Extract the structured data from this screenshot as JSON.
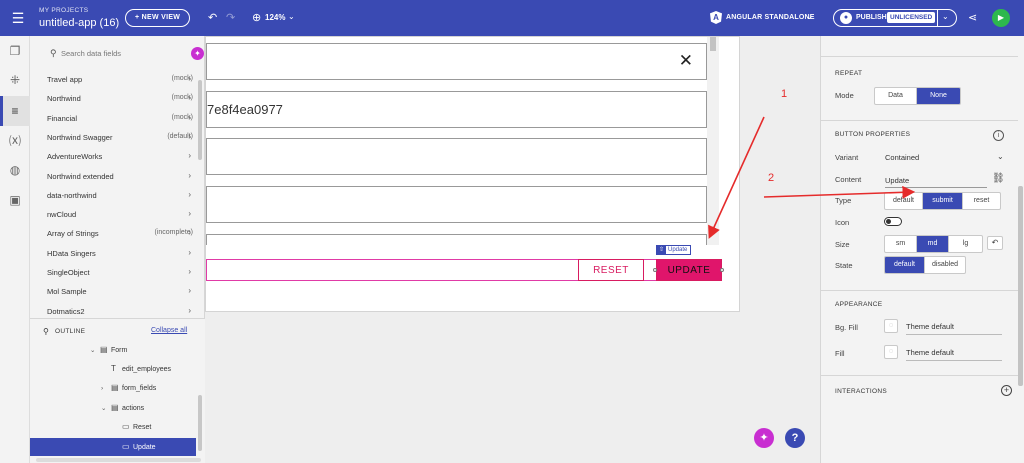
{
  "topbar": {
    "menu_icon": "hamburger-icon",
    "project_caption": "MY PROJECTS",
    "project_name": "untitled-app (16)",
    "new_view_label": "+ NEW VIEW",
    "zoom_value": "124%",
    "framework_label": "ANGULAR STANDALONE",
    "publish_label": "PUBLISH",
    "license_badge": "UNLICENSED",
    "accent": "#3a4ab3",
    "run_color": "#2db84d"
  },
  "datasources": {
    "search_placeholder": "Search data fields",
    "items": [
      {
        "name": "Travel app",
        "tag": "(mock)"
      },
      {
        "name": "Northwind",
        "tag": "(mock)"
      },
      {
        "name": "Financial",
        "tag": "(mock)"
      },
      {
        "name": "Northwind Swagger",
        "tag": "(default)"
      },
      {
        "name": "AdventureWorks",
        "tag": ""
      },
      {
        "name": "Northwind extended",
        "tag": ""
      },
      {
        "name": "data-northwind",
        "tag": ""
      },
      {
        "name": "nwCloud",
        "tag": ""
      },
      {
        "name": "Array of Strings",
        "tag": "(incomplete)"
      },
      {
        "name": "HData Singers",
        "tag": ""
      },
      {
        "name": "SingleObject",
        "tag": ""
      },
      {
        "name": "Mol Sample",
        "tag": ""
      },
      {
        "name": "Dotmatics2",
        "tag": ""
      }
    ]
  },
  "outline": {
    "title": "OUTLINE",
    "collapse_all": "Collapse all",
    "tree": [
      {
        "label": "Form"
      },
      {
        "label": "edit_employees"
      },
      {
        "label": "form_fields"
      },
      {
        "label": "actions"
      },
      {
        "label": "Reset"
      },
      {
        "label": "Update"
      }
    ]
  },
  "canvas": {
    "field_value": "7e8f4ea0977",
    "reset_label": "RESET",
    "update_label": "UPDATE",
    "selection_tag": "Update",
    "update_color": "#e0156b",
    "reset_color": "#d81b60"
  },
  "properties": {
    "repeat_title": "REPEAT",
    "mode_label": "Mode",
    "mode_options": [
      "Data",
      "None"
    ],
    "mode_selected": "None",
    "button_title": "BUTTON PROPERTIES",
    "variant_label": "Variant",
    "variant_value": "Contained",
    "content_label": "Content",
    "content_value": "Update",
    "type_label": "Type",
    "type_options": [
      "default",
      "submit",
      "reset"
    ],
    "type_selected": "submit",
    "icon_label": "Icon",
    "size_label": "Size",
    "size_options": [
      "sm",
      "md",
      "lg"
    ],
    "size_selected": "md",
    "state_label": "State",
    "state_options": [
      "default",
      "disabled"
    ],
    "state_selected": "default",
    "appearance_title": "APPEARANCE",
    "bg_fill_label": "Bg. Fill",
    "bg_fill_value": "Theme default",
    "fill_label": "Fill",
    "fill_value": "Theme default",
    "interactions_title": "INTERACTIONS"
  },
  "annotations": {
    "step1": "1",
    "step2": "2",
    "arrow_color": "#e52b2b"
  }
}
